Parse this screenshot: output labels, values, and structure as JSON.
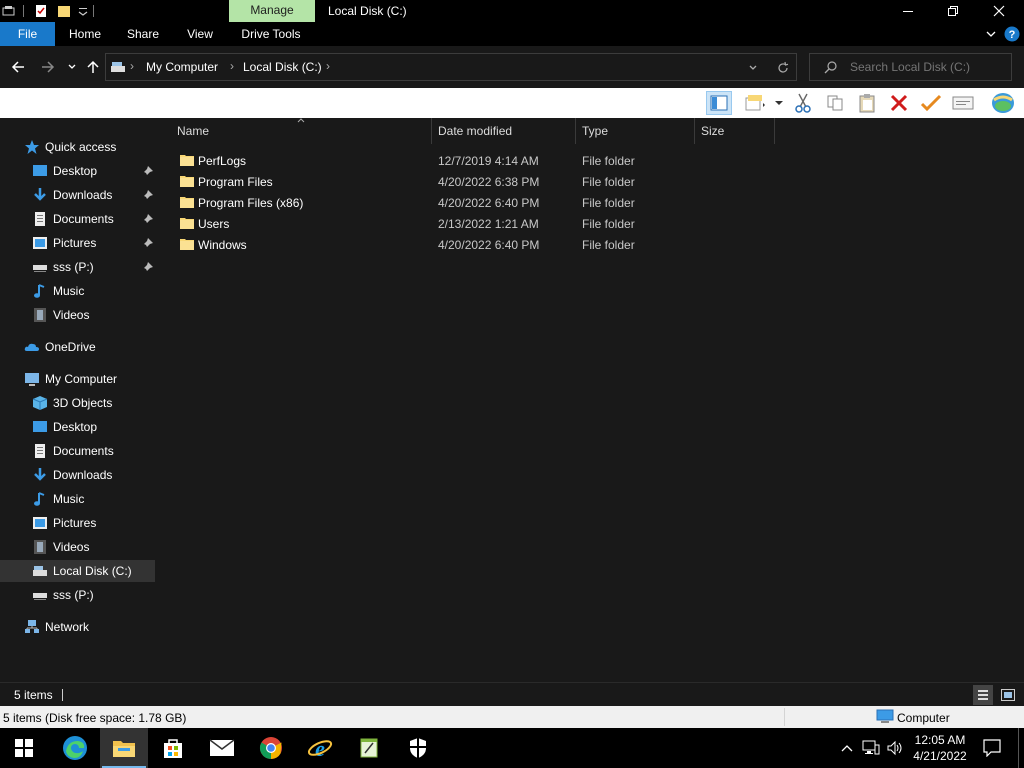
{
  "titlebar": {
    "manage_label": "Manage",
    "window_title": "Local Disk (C:)"
  },
  "ribbon": {
    "tabs": [
      "File",
      "Home",
      "Share",
      "View",
      "Drive Tools"
    ]
  },
  "address": {
    "crumbs": [
      "My Computer",
      "Local Disk (C:)"
    ]
  },
  "search": {
    "placeholder": "Search Local Disk (C:)"
  },
  "nav": {
    "quick_access": "Quick access",
    "quick_items": [
      "Desktop",
      "Downloads",
      "Documents",
      "Pictures",
      "sss (P:)",
      "Music",
      "Videos"
    ],
    "onedrive": "OneDrive",
    "my_computer": "My Computer",
    "computer_items": [
      "3D Objects",
      "Desktop",
      "Documents",
      "Downloads",
      "Music",
      "Pictures",
      "Videos",
      "Local Disk (C:)",
      "sss (P:)"
    ],
    "network": "Network"
  },
  "columns": {
    "name": "Name",
    "date": "Date modified",
    "type": "Type",
    "size": "Size"
  },
  "files": [
    {
      "name": "PerfLogs",
      "date": "12/7/2019 4:14 AM",
      "type": "File folder"
    },
    {
      "name": "Program Files",
      "date": "4/20/2022 6:38 PM",
      "type": "File folder"
    },
    {
      "name": "Program Files (x86)",
      "date": "4/20/2022 6:40 PM",
      "type": "File folder"
    },
    {
      "name": "Users",
      "date": "2/13/2022 1:21 AM",
      "type": "File folder"
    },
    {
      "name": "Windows",
      "date": "4/20/2022 6:40 PM",
      "type": "File folder"
    }
  ],
  "status": {
    "item_count": "5 items",
    "disk_info": "5 items (Disk free space: 1.78 GB)",
    "location": "Computer"
  },
  "taskbar": {
    "time": "12:05 AM",
    "date": "4/21/2022"
  },
  "colors": {
    "file_tab": "#1979ca",
    "manage_tab": "#b4e4a7",
    "folder": "#f8d775",
    "selected": "#333333"
  }
}
